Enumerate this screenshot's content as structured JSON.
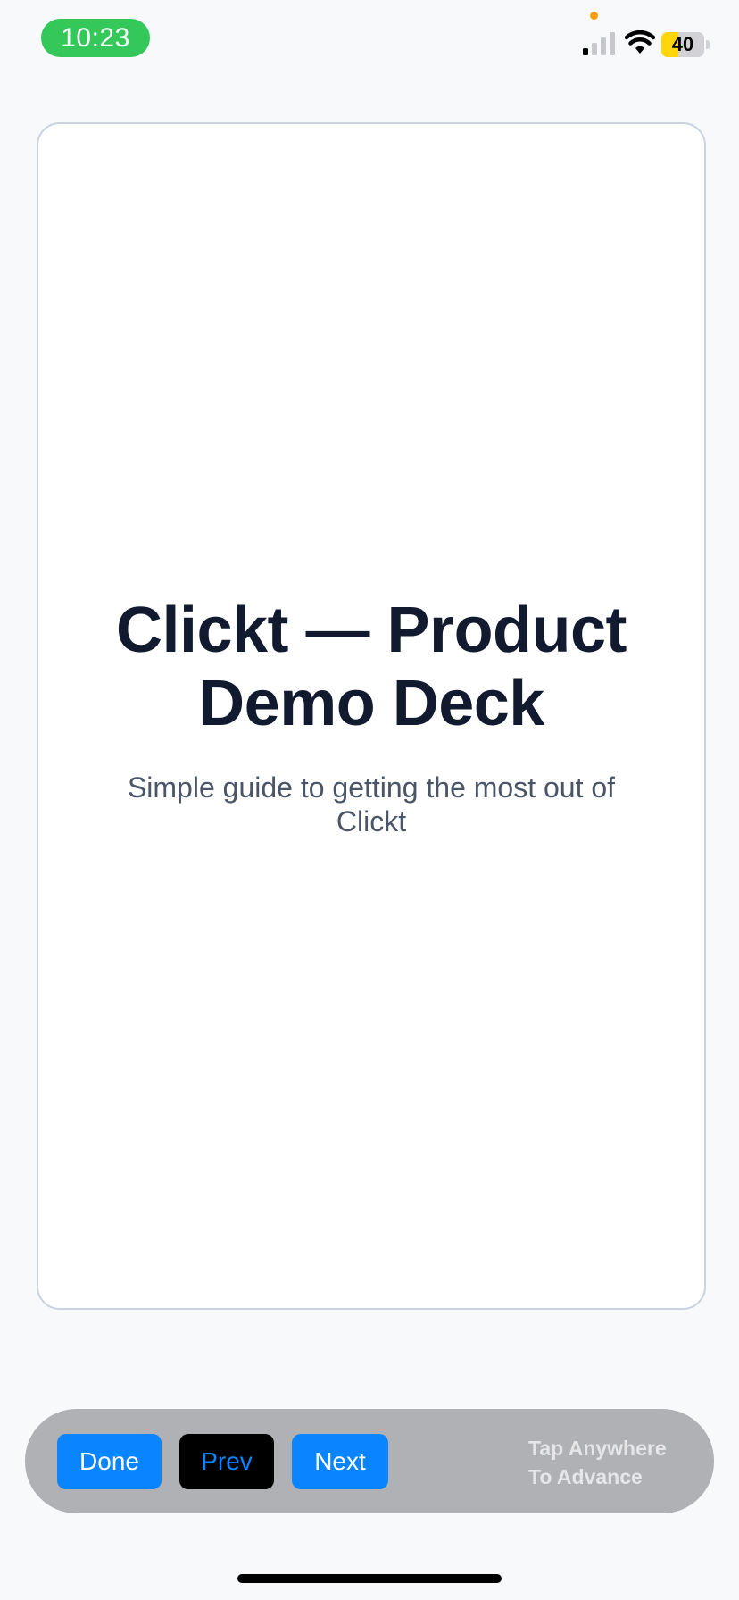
{
  "status_bar": {
    "time": "10:23",
    "battery_level": "40",
    "battery_fraction": 0.4,
    "cellular_bars_active": 1,
    "cellular_bars_total": 4,
    "icons": [
      "signal-icon",
      "wifi-icon",
      "battery-icon",
      "privacy-indicator-dot"
    ]
  },
  "slide": {
    "title": "Clickt — Product Demo Deck",
    "subtitle": "Simple guide to getting the most out of Clickt"
  },
  "controls": {
    "done_label": "Done",
    "prev_label": "Prev",
    "next_label": "Next",
    "hint_line1": "Tap Anywhere",
    "hint_line2": "To Advance"
  },
  "colors": {
    "accent": "#0a84ff",
    "time_pill": "#34c759",
    "battery_fill": "#ffd60a",
    "title_text": "#111a2e",
    "subtitle_text": "#4b5568"
  }
}
